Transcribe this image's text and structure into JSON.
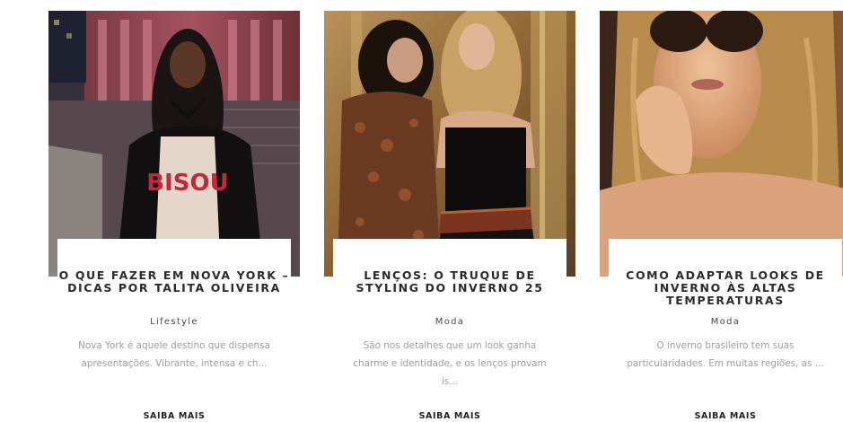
{
  "cards": [
    {
      "title": "O QUE FAZER EM NOVA YORK – DICAS POR TALITA OLIVEIRA",
      "category": "Lifestyle",
      "excerpt": "Nova York é aquele destino que dispensa apresentações. Vibrante, intensa e ch...",
      "cta": "SAIBA MAIS",
      "photo_text": "BISOU"
    },
    {
      "title": "LENÇOS: O TRUQUE DE STYLING DO INVERNO 25",
      "category": "Moda",
      "excerpt": "São nos detalhes que um look ganha charme e identidade, e os lenços provam is...",
      "cta": "SAIBA MAIS"
    },
    {
      "title": "COMO ADAPTAR LOOKS DE INVERNO ÀS ALTAS TEMPERATURAS",
      "category": "Moda",
      "excerpt": "O inverno brasileiro tem suas particularidades. Em muitas regiões, as ...",
      "cta": "SAIBA MAIS"
    }
  ],
  "colors": {
    "title": "#2b2b2b",
    "excerpt": "#9c9c9c",
    "background": "#ffffff"
  }
}
